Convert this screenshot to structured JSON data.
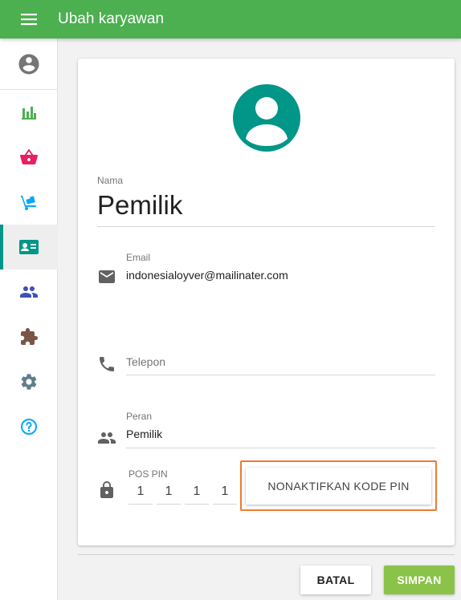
{
  "header": {
    "title": "Ubah karyawan"
  },
  "sidebar": {
    "items": [
      {
        "icon": "account-circle-icon",
        "color": "#757575"
      },
      {
        "icon": "bar-chart-icon",
        "color": "#4caf50"
      },
      {
        "icon": "basket-icon",
        "color": "#e91e63"
      },
      {
        "icon": "dolly-icon",
        "color": "#03a9f4"
      },
      {
        "icon": "employee-card-icon",
        "color": "#009688",
        "active": true
      },
      {
        "icon": "people-icon",
        "color": "#3f51b5"
      },
      {
        "icon": "puzzle-icon",
        "color": "#795548"
      },
      {
        "icon": "gear-icon",
        "color": "#607d8b"
      },
      {
        "icon": "help-icon",
        "color": "#03a9f4"
      }
    ]
  },
  "form": {
    "name": {
      "label": "Nama",
      "value": "Pemilik"
    },
    "email": {
      "label": "Email",
      "value": "indonesialoyver@mailinater.com"
    },
    "phone": {
      "placeholder": "Telepon",
      "value": ""
    },
    "role": {
      "label": "Peran",
      "value": "Pemilik"
    },
    "pin": {
      "label": "POS PIN",
      "digits": [
        "1",
        "1",
        "1",
        "1"
      ],
      "disable_label": "NONAKTIFKAN KODE PIN"
    }
  },
  "actions": {
    "cancel_label": "BATAL",
    "save_label": "SIMPAN"
  },
  "colors": {
    "primary": "#4caf50",
    "accent": "#009688",
    "save": "#8bc34a",
    "highlight": "#ee7a2d"
  }
}
